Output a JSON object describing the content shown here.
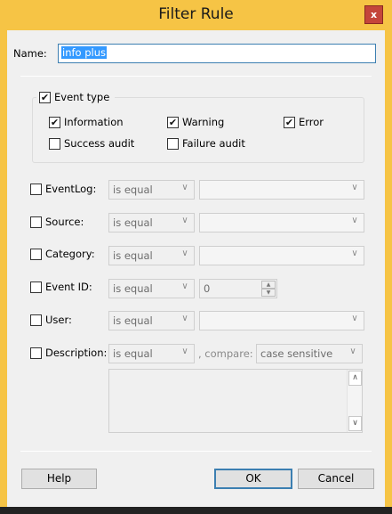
{
  "window": {
    "title": "Filter Rule",
    "close_glyph": "x"
  },
  "name": {
    "label": "Name:",
    "value": "info plus"
  },
  "event_type": {
    "label": "Event type",
    "checked": true,
    "options": [
      {
        "label": "Information",
        "checked": true
      },
      {
        "label": "Warning",
        "checked": true
      },
      {
        "label": "Error",
        "checked": true
      },
      {
        "label": "Success audit",
        "checked": false
      },
      {
        "label": "Failure audit",
        "checked": false
      }
    ]
  },
  "rows": [
    {
      "label": "EventLog:",
      "operator": "is equal",
      "value": ""
    },
    {
      "label": "Source:",
      "operator": "is equal",
      "value": ""
    },
    {
      "label": "Category:",
      "operator": "is equal",
      "value": ""
    },
    {
      "label": "Event ID:",
      "operator": "is equal",
      "value": "0"
    },
    {
      "label": "User:",
      "operator": "is equal",
      "value": ""
    },
    {
      "label": "Description:",
      "operator": "is equal",
      "compare_label": ", compare:",
      "compare_value": "case sensitive"
    }
  ],
  "buttons": {
    "help": "Help",
    "ok": "OK",
    "cancel": "Cancel"
  },
  "colors": {
    "title_bar": "#f6c445",
    "close": "#c4453a",
    "selection": "#3399ff"
  }
}
